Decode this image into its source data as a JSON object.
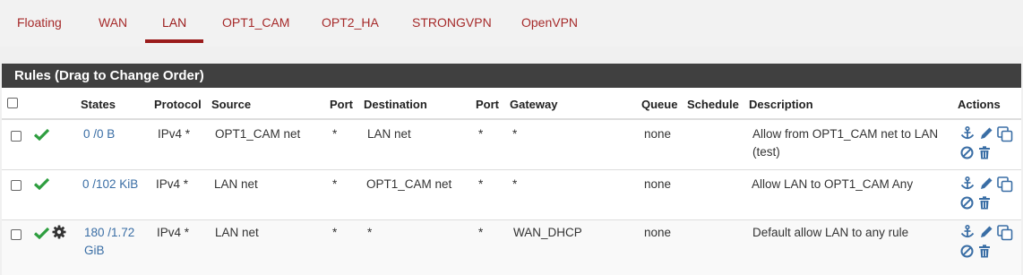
{
  "tabs": [
    {
      "label": "Floating"
    },
    {
      "label": "WAN"
    },
    {
      "label": "LAN"
    },
    {
      "label": "OPT1_CAM"
    },
    {
      "label": "OPT2_HA"
    },
    {
      "label": "STRONGVPN"
    },
    {
      "label": "OpenVPN"
    }
  ],
  "active_tab": "LAN",
  "panel": {
    "title": "Rules (Drag to Change Order)"
  },
  "columns": {
    "states": "States",
    "protocol": "Protocol",
    "source": "Source",
    "port": "Port",
    "destination": "Destination",
    "port2": "Port",
    "gateway": "Gateway",
    "queue": "Queue",
    "schedule": "Schedule",
    "description": "Description",
    "actions": "Actions"
  },
  "rows": [
    {
      "states": "0 /0 B",
      "protocol": "IPv4 *",
      "source": "OPT1_CAM net",
      "port": "*",
      "destination": "LAN net",
      "port2": "*",
      "gateway": "*",
      "queue": "none",
      "schedule": "",
      "description": "Allow from OPT1_CAM net to LAN (test)"
    },
    {
      "states": "0 /102 KiB",
      "protocol": "IPv4 *",
      "source": "LAN net",
      "port": "*",
      "destination": "OPT1_CAM net",
      "port2": "*",
      "gateway": "*",
      "queue": "none",
      "schedule": "",
      "description": "Allow LAN to OPT1_CAM Any"
    },
    {
      "states": "180 /1.72 GiB",
      "protocol": "IPv4 *",
      "source": "LAN net",
      "port": "*",
      "destination": "*",
      "port2": "*",
      "gateway": "WAN_DHCP",
      "queue": "none",
      "schedule": "",
      "description": "Default allow LAN to any rule"
    }
  ],
  "colors": {
    "accent": "#9b1c1c",
    "pass": "#2e9e3f",
    "link": "#3a6ea5",
    "panel_header": "#404040"
  },
  "icons": {
    "pass": "check-icon",
    "advanced": "gear-icon",
    "anchor": "anchor-icon",
    "edit": "pencil-icon",
    "copy": "copy-icon",
    "disable": "ban-icon",
    "delete": "trash-icon"
  }
}
